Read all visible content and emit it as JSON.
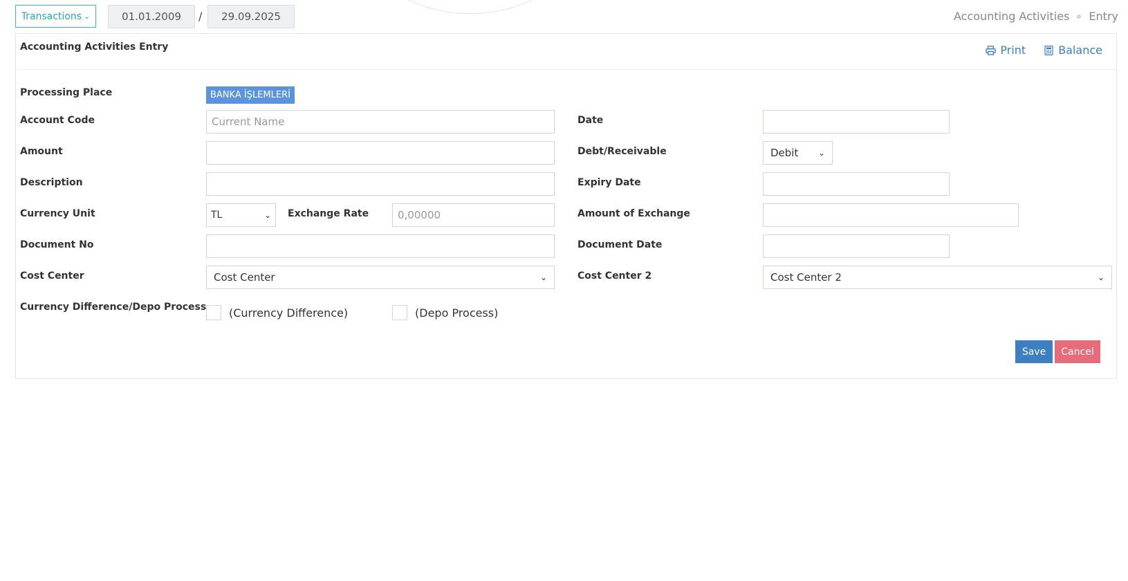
{
  "toolbar": {
    "transactions_label": "Transactions",
    "date_start": "01.01.2009",
    "date_separator": "/",
    "date_end": "29.09.2025"
  },
  "breadcrumb": {
    "items": [
      "Accounting Activities",
      "Entry"
    ]
  },
  "panel": {
    "title": "Accounting Activities Entry",
    "print_label": "Print",
    "balance_label": "Balance"
  },
  "form": {
    "processing_place_label": "Processing Place",
    "processing_place_value": "BANKA İŞLEMLERİ",
    "account_code_label": "Account Code",
    "account_code_placeholder": "Current Name",
    "date_label": "Date",
    "amount_label": "Amount",
    "debt_receivable_label": "Debt/Receivable",
    "debt_receivable_value": "Debit",
    "description_label": "Description",
    "expiry_date_label": "Expiry Date",
    "currency_unit_label": "Currency Unit",
    "currency_unit_value": "TL",
    "exchange_rate_label": "Exchange Rate",
    "exchange_rate_placeholder": "0,00000",
    "amount_of_exchange_label": "Amount of Exchange",
    "document_no_label": "Document No",
    "document_date_label": "Document Date",
    "cost_center_label": "Cost Center",
    "cost_center_value": "Cost Center",
    "cost_center_2_label": "Cost Center 2",
    "cost_center_2_value": "Cost Center 2",
    "currency_depo_label": "Currency Difference/Depo Process",
    "currency_difference_label": "(Currency Difference)",
    "depo_process_label": "(Depo Process)"
  },
  "buttons": {
    "save_label": "Save",
    "cancel_label": "Cancel"
  },
  "colors": {
    "accent": "#3d7fc1",
    "teal": "#26a7bd",
    "cancel": "#e76b7b",
    "badge": "#5b94d8"
  }
}
